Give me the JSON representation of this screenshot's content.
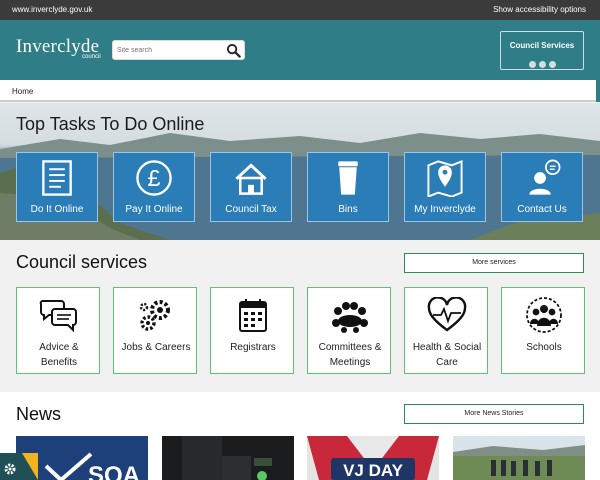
{
  "topbar": {
    "url": "www.inverclyde.gov.uk",
    "accessibility": "Show accessibility options"
  },
  "header": {
    "logo_text": "Inverclyde",
    "logo_sub": "council",
    "search_placeholder": "Site search",
    "council_services_label": "Council Services"
  },
  "breadcrumb": {
    "home": "Home"
  },
  "top_tasks": {
    "title": "Top Tasks To Do Online",
    "items": [
      {
        "label": "Do It Online",
        "icon": "document-icon"
      },
      {
        "label": "Pay It Online",
        "icon": "pound-icon"
      },
      {
        "label": "Council Tax",
        "icon": "house-icon"
      },
      {
        "label": "Bins",
        "icon": "bin-icon"
      },
      {
        "label": "My Inverclyde",
        "icon": "map-pin-icon"
      },
      {
        "label": "Contact Us",
        "icon": "contact-icon"
      }
    ]
  },
  "council_services": {
    "title": "Council services",
    "more_label": "More services",
    "items": [
      {
        "line1": "Advice &",
        "line2": "Benefits",
        "icon": "speech-bubbles-icon"
      },
      {
        "line1": "Jobs & Careers",
        "line2": "",
        "icon": "gears-icon"
      },
      {
        "line1": "Registrars",
        "line2": "",
        "icon": "calendar-icon"
      },
      {
        "line1": "Committees &",
        "line2": "Meetings",
        "icon": "meeting-icon"
      },
      {
        "line1": "Health & Social",
        "line2": "Care",
        "icon": "heart-icon"
      },
      {
        "line1": "Schools",
        "line2": "",
        "icon": "group-icon"
      }
    ]
  },
  "news": {
    "title": "News",
    "more_label": "More News Stories",
    "cards": [
      {
        "caption": "SQA"
      },
      {
        "caption": ""
      },
      {
        "caption": "VJ DAY"
      },
      {
        "caption": ""
      }
    ]
  },
  "colors": {
    "brand": "#2f7d86",
    "tile_blue": "#2b7db8",
    "service_border": "#5fbf73",
    "dark_bar": "#3b3b3b"
  }
}
